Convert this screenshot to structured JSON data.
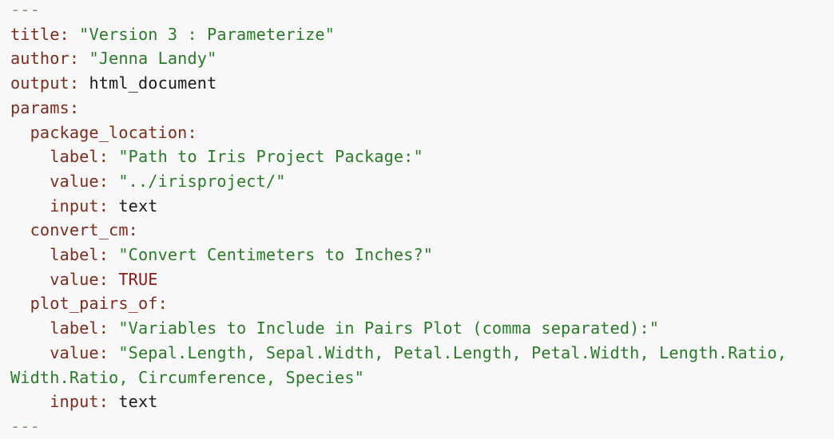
{
  "lines": [
    {
      "indent": "",
      "key": "---",
      "sep": "",
      "value": "",
      "kind": "delim"
    },
    {
      "indent": "",
      "key": "title",
      "sep": ": ",
      "value": "\"Version 3 : Parameterize\"",
      "kind": "str"
    },
    {
      "indent": "",
      "key": "author",
      "sep": ": ",
      "value": "\"Jenna Landy\"",
      "kind": "str"
    },
    {
      "indent": "",
      "key": "output",
      "sep": ": ",
      "value": "html_document",
      "kind": "plain"
    },
    {
      "indent": "",
      "key": "params",
      "sep": ":",
      "value": "",
      "kind": "plain"
    },
    {
      "indent": "  ",
      "key": "package_location",
      "sep": ":",
      "value": "",
      "kind": "plain"
    },
    {
      "indent": "    ",
      "key": "label",
      "sep": ": ",
      "value": "\"Path to Iris Project Package:\"",
      "kind": "str"
    },
    {
      "indent": "    ",
      "key": "value",
      "sep": ": ",
      "value": "\"../irisproject/\"",
      "kind": "str"
    },
    {
      "indent": "    ",
      "key": "input",
      "sep": ": ",
      "value": "text",
      "kind": "plain"
    },
    {
      "indent": "  ",
      "key": "convert_cm",
      "sep": ":",
      "value": "",
      "kind": "plain"
    },
    {
      "indent": "    ",
      "key": "label",
      "sep": ": ",
      "value": "\"Convert Centimeters to Inches?\"",
      "kind": "str"
    },
    {
      "indent": "    ",
      "key": "value",
      "sep": ": ",
      "value": "TRUE",
      "kind": "kw"
    },
    {
      "indent": "  ",
      "key": "plot_pairs_of",
      "sep": ":",
      "value": "",
      "kind": "plain"
    },
    {
      "indent": "    ",
      "key": "label",
      "sep": ": ",
      "value": "\"Variables to Include in Pairs Plot (comma separated):\"",
      "kind": "str"
    },
    {
      "indent": "    ",
      "key": "value",
      "sep": ": ",
      "value": "\"Sepal.Length, Sepal.Width, Petal.Length, Petal.Width, Length.Ratio,",
      "kind": "str"
    },
    {
      "indent": "",
      "key": "",
      "sep": "",
      "value": "Width.Ratio, Circumference, Species\"",
      "kind": "str"
    },
    {
      "indent": "    ",
      "key": "input",
      "sep": ": ",
      "value": "text",
      "kind": "plain"
    },
    {
      "indent": "",
      "key": "---",
      "sep": "",
      "value": "",
      "kind": "delim"
    }
  ]
}
